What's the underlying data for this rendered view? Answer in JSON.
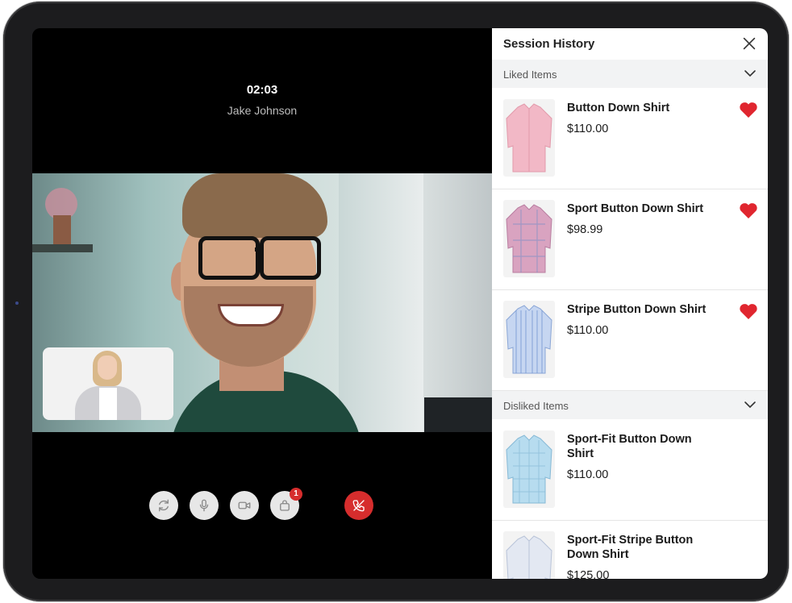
{
  "call": {
    "timer": "02:03",
    "caller_name": "Jake Johnson",
    "controls": [
      {
        "name": "switch-camera-button",
        "icon": "refresh-icon"
      },
      {
        "name": "mute-button",
        "icon": "microphone-icon"
      },
      {
        "name": "video-button",
        "icon": "video-camera-icon"
      },
      {
        "name": "bag-button",
        "icon": "shopping-bag-icon",
        "badge": "1"
      },
      {
        "name": "end-call-button",
        "icon": "phone-end-icon"
      }
    ],
    "end_call_color": "#d62d2d"
  },
  "panel": {
    "title": "Session History",
    "liked": {
      "label": "Liked Items",
      "items": [
        {
          "name": "Button Down Shirt",
          "price": "$110.00",
          "color": "#f2b8c6"
        },
        {
          "name": "Sport Button Down Shirt",
          "price": "$98.99",
          "color": "#d9a3c0"
        },
        {
          "name": "Stripe Button Down Shirt",
          "price": "$110.00",
          "color": "#a9c3e8"
        }
      ]
    },
    "disliked": {
      "label": "Disliked Items",
      "items": [
        {
          "name": "Sport-Fit Button Down Shirt",
          "price": "$110.00",
          "color": "#b7dcef"
        },
        {
          "name": "Sport-Fit Stripe Button Down Shirt",
          "price": "$125.00",
          "color": "#e3e8f2"
        }
      ]
    },
    "heart_color": "#e0262f"
  }
}
